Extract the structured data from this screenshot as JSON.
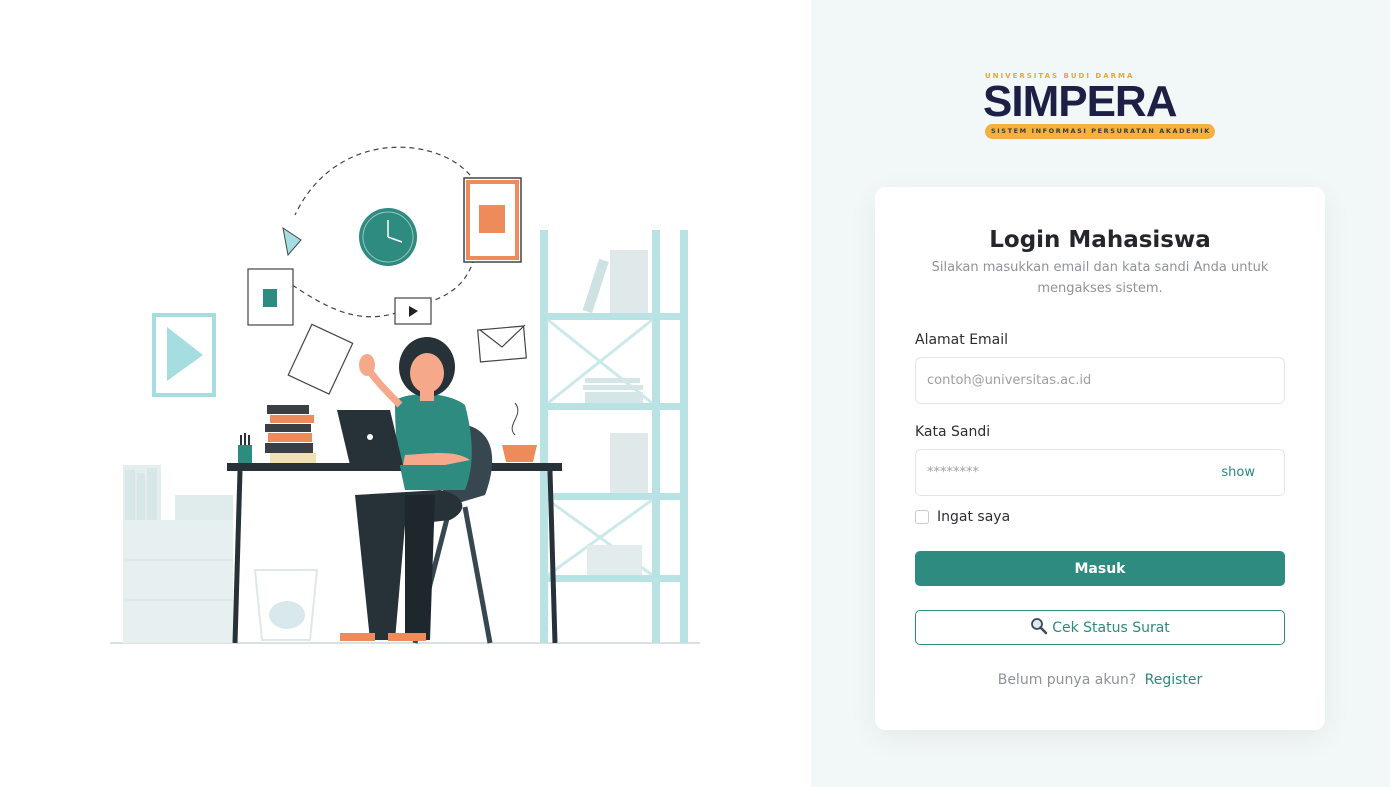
{
  "logo": {
    "top_text": "UNIVERSITAS BUDI DARMA",
    "main_text": "SIMPERA",
    "tagline": "SISTEM INFORMASI PERSURATAN AKADEMIK"
  },
  "login": {
    "title": "Login Mahasiswa",
    "subtitle": "Silakan masukkan email dan kata sandi Anda untuk mengakses sistem.",
    "email_label": "Alamat Email",
    "email_placeholder": "contoh@universitas.ac.id",
    "password_label": "Kata Sandi",
    "password_placeholder": "********",
    "show_label": "show",
    "remember_label": "Ingat saya",
    "submit_label": "Masuk",
    "check_status_label": "Cek Status Surat",
    "footer_question": "Belum punya akun?",
    "footer_link": "Register"
  },
  "colors": {
    "primary": "#2e8b80",
    "brand_dark": "#1d2044",
    "brand_accent": "#f4b13e",
    "right_background": "#f2f7f7"
  },
  "icons": {
    "check_status": "magnifier-icon"
  }
}
